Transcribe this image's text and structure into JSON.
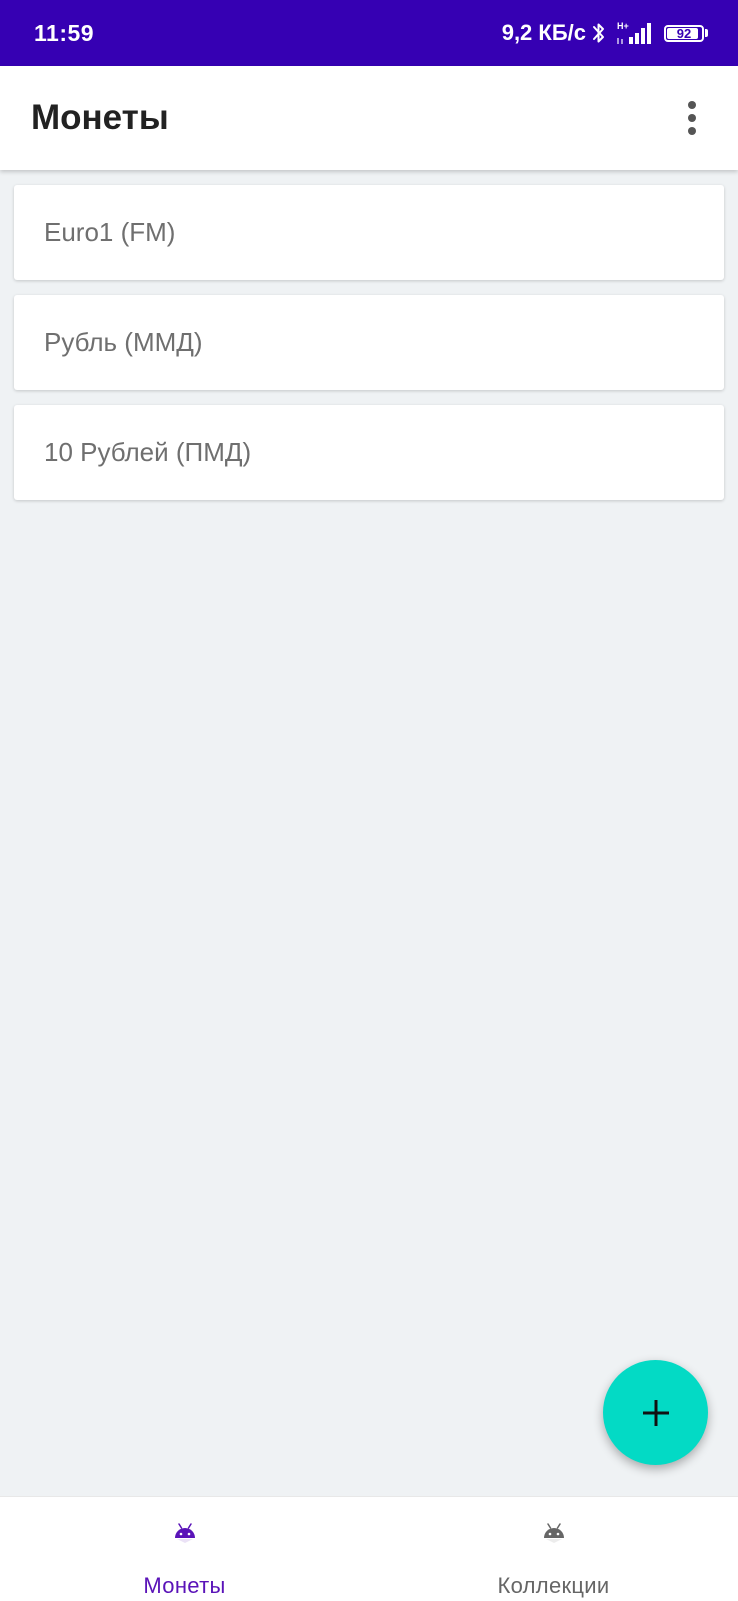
{
  "status_bar": {
    "time": "11:59",
    "net_speed": "9,2 КБ/с",
    "network_type": "H+",
    "battery_level": "92",
    "icons": [
      "bluetooth-icon",
      "signal-icon",
      "battery-icon"
    ],
    "background_color": "#3600b3"
  },
  "app_bar": {
    "title": "Монеты",
    "overflow_icon": "more-vert-icon"
  },
  "coins": [
    {
      "label": "Euro1 (FM)"
    },
    {
      "label": "Рубль (ММД)"
    },
    {
      "label": "10 Рублей (ПМД)"
    }
  ],
  "fab": {
    "icon": "plus-icon",
    "color": "#03dac5"
  },
  "bottom_nav": {
    "items": [
      {
        "label": "Монеты",
        "icon": "android-icon",
        "active": true,
        "color": "#5a13b8"
      },
      {
        "label": "Коллекции",
        "icon": "android-icon",
        "active": false,
        "color": "#666666"
      }
    ]
  }
}
